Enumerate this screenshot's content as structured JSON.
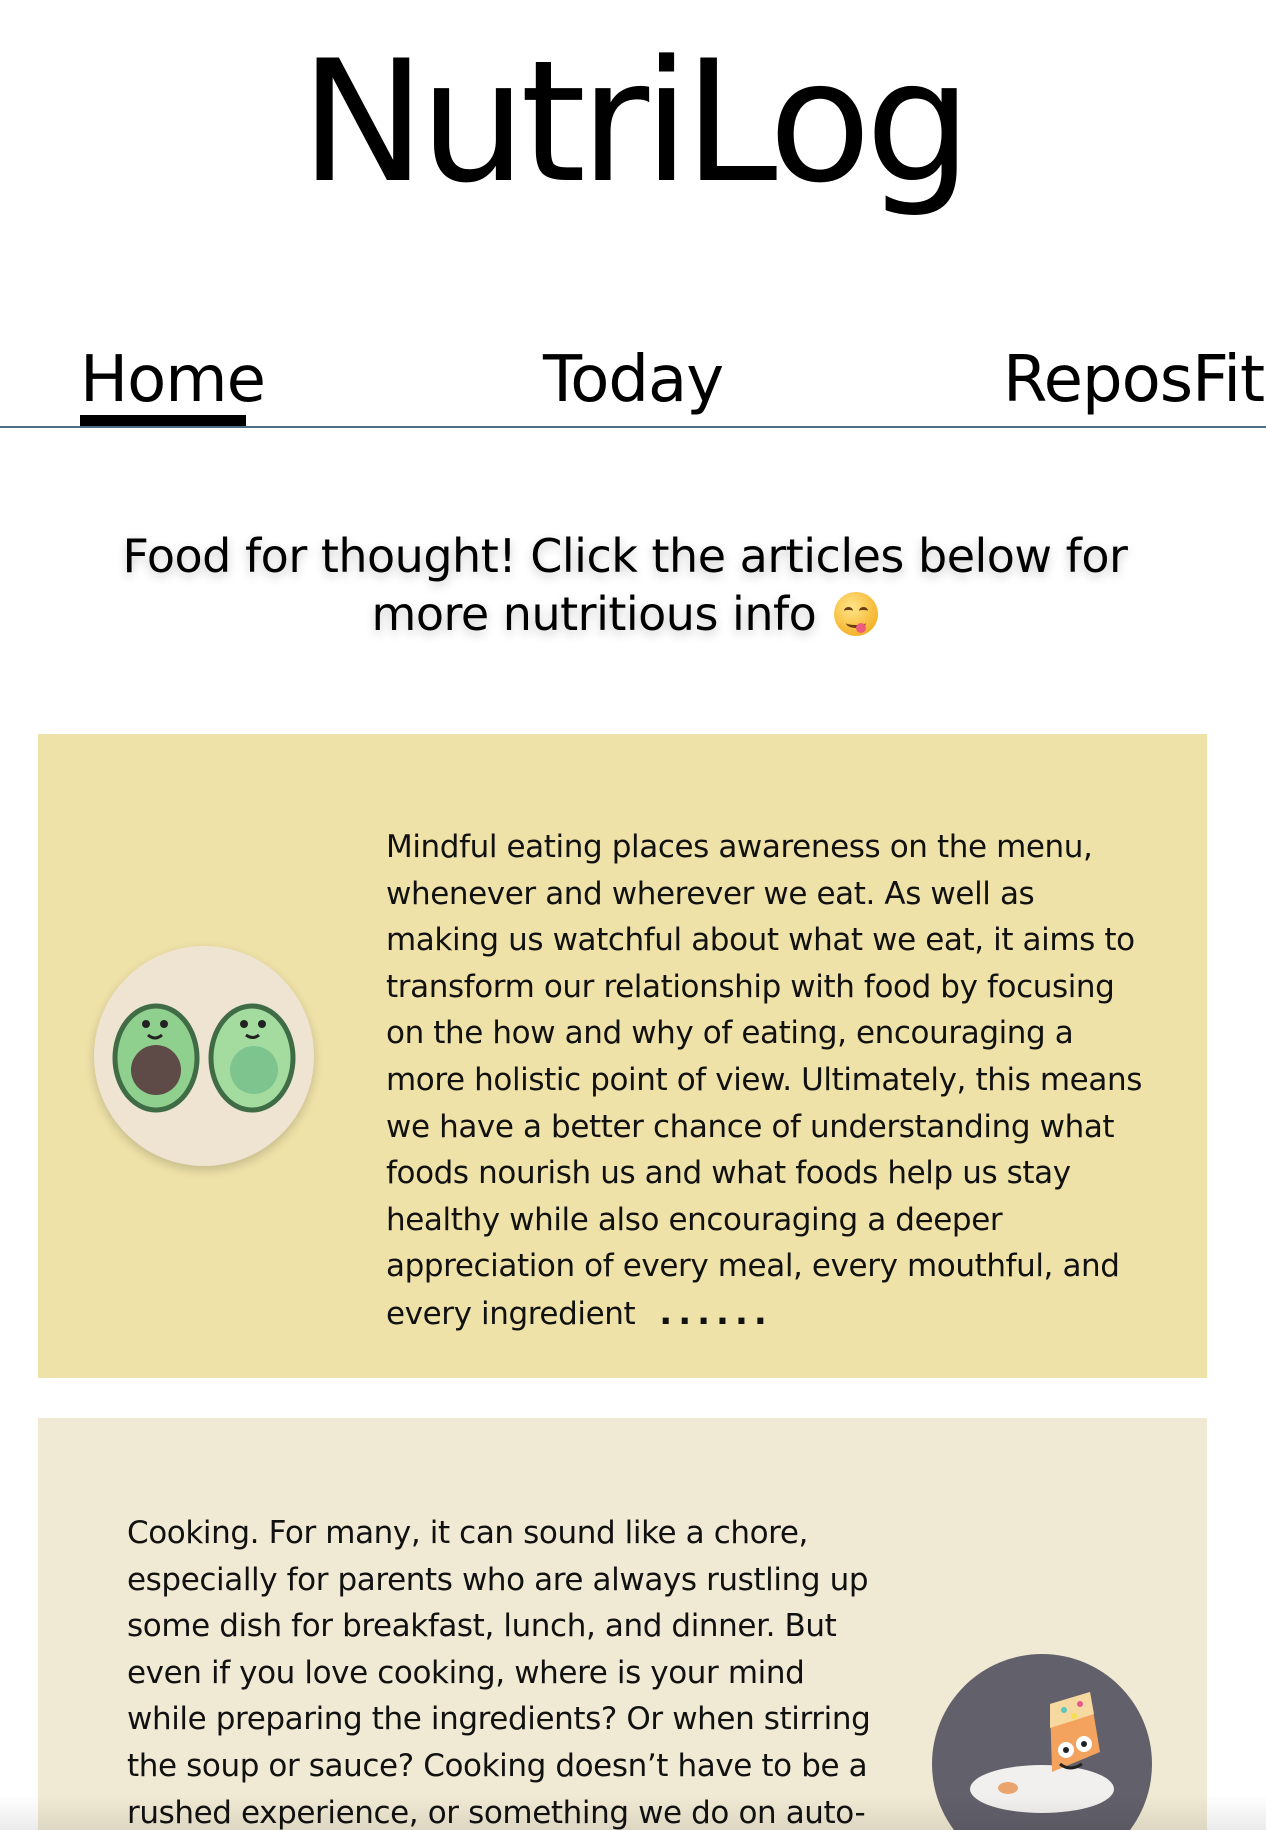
{
  "app": {
    "title": "NutriLog"
  },
  "nav": {
    "items": [
      {
        "label": "Home",
        "active": true
      },
      {
        "label": "Today",
        "active": false
      },
      {
        "label": "ReposFit",
        "active": false
      }
    ]
  },
  "intro": {
    "text": "Food for thought! Click the articles below for more nutritious info",
    "emoji": "yum-face-icon"
  },
  "articles": [
    {
      "text": "Mindful eating places awareness on the menu, whenever and wherever we eat. As well as making us watchful about what we eat, it aims to transform our relationship with food by focusing on the how and why of eating, encouraging a more holistic point of view. Ultimately, this means we have a better chance of understanding what foods nourish us and what foods help us stay healthy while also encouraging a deeper appreciation of every meal, every mouthful, and every ingredient",
      "more": "......",
      "illustration": "avocado-pair-icon",
      "background": "#efe2a8"
    },
    {
      "text": "Cooking. For many, it can sound like a chore, especially for parents who are always rustling up some dish for breakfast, lunch, and dinner. But even if you love cooking, where is your mind while preparing the ingredients? Or when stirring the soup or sauce? Cooking doesn’t have to be a rushed experience, or something we do on auto-pilot,",
      "illustration": "cake-slice-icon",
      "background": "#f0e9d3"
    }
  ],
  "colors": {
    "nav_border": "#4d6f83",
    "card1_bg": "#efe2a8",
    "card2_bg": "#f0e9d3"
  }
}
